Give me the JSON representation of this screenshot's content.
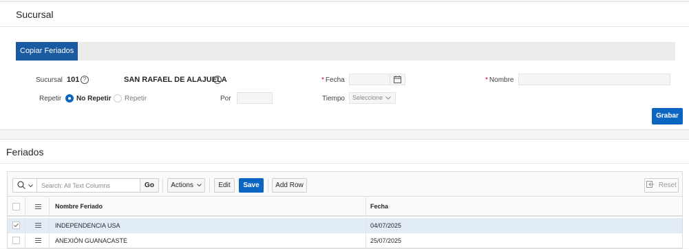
{
  "region1": {
    "title": "Sucursal",
    "tab_label": "Copiar Feriados",
    "sucursal_label": "Sucursal",
    "sucursal_code": "101",
    "sucursal_name": "SAN RAFAEL DE ALAJUELA",
    "fecha_label": "Fecha",
    "nombre_label": "Nombre",
    "repetir_label": "Repetir",
    "radio_no_repetir": "No Repetir",
    "radio_repetir": "Repetir",
    "radio_selected": "No Repetir",
    "por_label": "Por",
    "tiempo_label": "Tiempo",
    "tiempo_value": "Seleccione",
    "grabar_label": "Grabar",
    "help_glyph": "?",
    "required_mark": "*"
  },
  "region2": {
    "title": "Feriados",
    "search_placeholder": "Search: All Text Columns",
    "go_label": "Go",
    "actions_label": "Actions",
    "edit_label": "Edit",
    "save_label": "Save",
    "add_row_label": "Add Row",
    "reset_label": "Reset",
    "columns": [
      "Nombre Feriado",
      "Fecha"
    ],
    "rows": [
      {
        "nombre": "INDEPENDENCIA USA",
        "fecha": "04/07/2025",
        "selected": true
      },
      {
        "nombre": "ANEXIÓN GUANACASTE",
        "fecha": "25/07/2025",
        "selected": false
      }
    ]
  },
  "colors": {
    "primary": "#0a66c2",
    "tab_active": "#1a5aa0",
    "required": "#d0021b",
    "selected_row": "#e2ecf7"
  },
  "icons": [
    "help-icon",
    "calendar-icon",
    "search-icon",
    "chevron-down-icon",
    "hamburger-icon",
    "checkbox-icon",
    "reset-icon"
  ]
}
